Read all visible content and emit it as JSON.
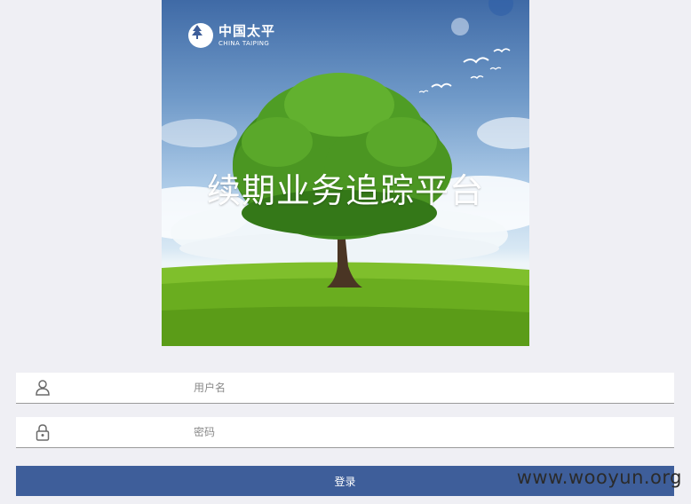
{
  "banner": {
    "brand_name_cn": "中国太平",
    "brand_name_en": "CHINA TAIPING",
    "title": "续期业务追踪平台"
  },
  "login_form": {
    "username_placeholder": "用户名",
    "password_placeholder": "密码",
    "login_label": "登录"
  },
  "watermark": "www.wooyun.org",
  "icons": {
    "brand": "china-taiping-logo-icon",
    "username": "user-icon",
    "password": "lock-icon"
  },
  "colors": {
    "page_background": "#efeff4",
    "button": "#3e5e9a",
    "field_background": "#ffffff",
    "field_border": "#9a9a9a"
  }
}
